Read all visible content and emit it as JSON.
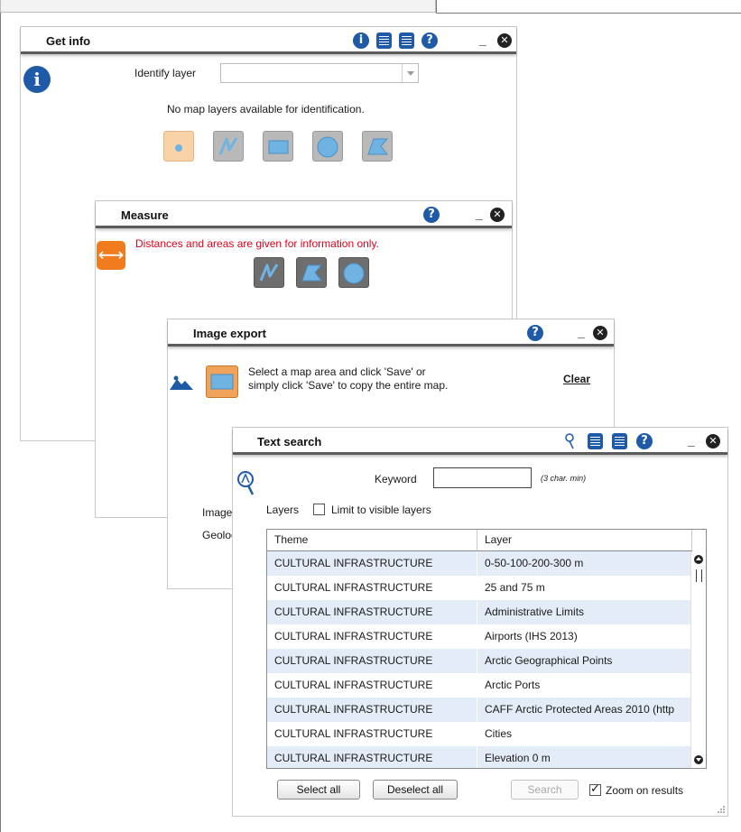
{
  "get_info": {
    "title": "Get info",
    "identify_label": "Identify layer",
    "identify_value": "",
    "message": "No map layers available for identification.",
    "tools": [
      "point-tool",
      "line-tool",
      "rectangle-tool",
      "circle-tool",
      "polygon-tool"
    ],
    "header_icons": [
      "info-icon",
      "list-icon",
      "list-icon",
      "help-icon",
      "minimize-icon",
      "close-icon"
    ]
  },
  "measure": {
    "title": "Measure",
    "warning": "Distances and areas are given for information only.",
    "warning_color": "#e0001b",
    "tools": [
      "line-tool",
      "polygon-tool",
      "circle-tool"
    ]
  },
  "image_export": {
    "title": "Image export",
    "instructions_line1": "Select a map area and click 'Save' or",
    "instructions_line2": "simply click 'Save' to copy the entire map.",
    "clear_label": "Clear",
    "image_format_label": "Image format",
    "geolocate_label": "Geolocate map"
  },
  "text_search": {
    "title": "Text search",
    "keyword_label": "Keyword",
    "keyword_value": "",
    "keyword_hint": "(3 char. min)",
    "layers_label": "Layers",
    "limit_visible_label": "Limit to visible layers",
    "limit_visible_checked": false,
    "columns": [
      "Theme",
      "Layer"
    ],
    "rows": [
      {
        "theme": "CULTURAL INFRASTRUCTURE",
        "layer": "0-50-100-200-300 m"
      },
      {
        "theme": "CULTURAL INFRASTRUCTURE",
        "layer": "25 and 75 m"
      },
      {
        "theme": "CULTURAL INFRASTRUCTURE",
        "layer": "Administrative Limits"
      },
      {
        "theme": "CULTURAL INFRASTRUCTURE",
        "layer": "Airports (IHS 2013)"
      },
      {
        "theme": "CULTURAL INFRASTRUCTURE",
        "layer": "Arctic Geographical Points"
      },
      {
        "theme": "CULTURAL INFRASTRUCTURE",
        "layer": "Arctic Ports"
      },
      {
        "theme": "CULTURAL INFRASTRUCTURE",
        "layer": "CAFF Arctic Protected Areas 2010 (http"
      },
      {
        "theme": "CULTURAL INFRASTRUCTURE",
        "layer": "Cities"
      },
      {
        "theme": "CULTURAL INFRASTRUCTURE",
        "layer": "Elevation 0 m"
      }
    ],
    "select_all_label": "Select all",
    "deselect_all_label": "Deselect all",
    "search_label": "Search",
    "zoom_label": "Zoom on results",
    "zoom_checked": true
  },
  "colors": {
    "accent_blue": "#1e5aa8",
    "measure_orange": "#f07c1e",
    "row_alt": "#e4ecf7"
  }
}
